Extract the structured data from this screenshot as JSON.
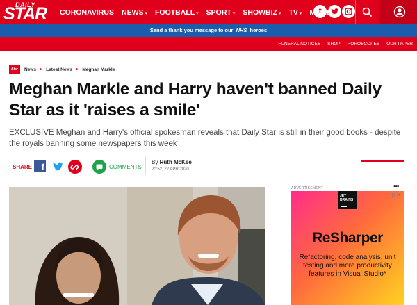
{
  "logo": {
    "daily": "DAILY",
    "star": "STAR"
  },
  "nav": {
    "items": [
      {
        "label": "CORONAVIRUS",
        "dropdown": false
      },
      {
        "label": "NEWS",
        "dropdown": true
      },
      {
        "label": "FOOTBALL",
        "dropdown": true
      },
      {
        "label": "SPORT",
        "dropdown": true
      },
      {
        "label": "SHOWBIZ",
        "dropdown": true
      },
      {
        "label": "TV",
        "dropdown": true
      },
      {
        "label": "MORE",
        "dropdown": true
      }
    ],
    "caret": "▾"
  },
  "social": {
    "facebook": "f",
    "instagram_icon": "instagram-icon",
    "twitter_icon": "twitter-icon"
  },
  "nhs_banner": {
    "prefix": "Send a thank you message to our",
    "nhs": "NHS",
    "suffix": "heroes"
  },
  "subnav": [
    "FUNERAL NOTICES",
    "SHOP",
    "HOROSCOPES",
    "OUR PAPER"
  ],
  "breadcrumb": {
    "logo": "Star",
    "items": [
      "News",
      "Latest News",
      "Meghan Markle"
    ],
    "sep": "▶"
  },
  "article": {
    "headline": "Meghan Markle and Harry haven't banned Daily Star as it 'raises a smile'",
    "subhead": "EXCLUSIVE Meghan and Harry's official spokesman reveals that Daily Star is still in their good books - despite the royals banning some newspapers this week",
    "share_label": "SHARE",
    "comments_label": "COMMENTS",
    "byline_prefix": "By",
    "author": "Ruth McKee",
    "date": "20:52, 22 APR 2020"
  },
  "ad": {
    "label": "ADVERTISEMENT",
    "badge_line1": "JET",
    "badge_line2": "BRAINS",
    "close": "▷✕",
    "title": "ReSharper",
    "body": "Refactoring, code analysis, unit testing and more productivity features in Visual Studio*",
    "dots": "•••"
  },
  "colors": {
    "brand_red": "#e0001b",
    "nhs_blue": "#1a5dad",
    "facebook": "#3b5998",
    "comments_green": "#1fa24a"
  }
}
